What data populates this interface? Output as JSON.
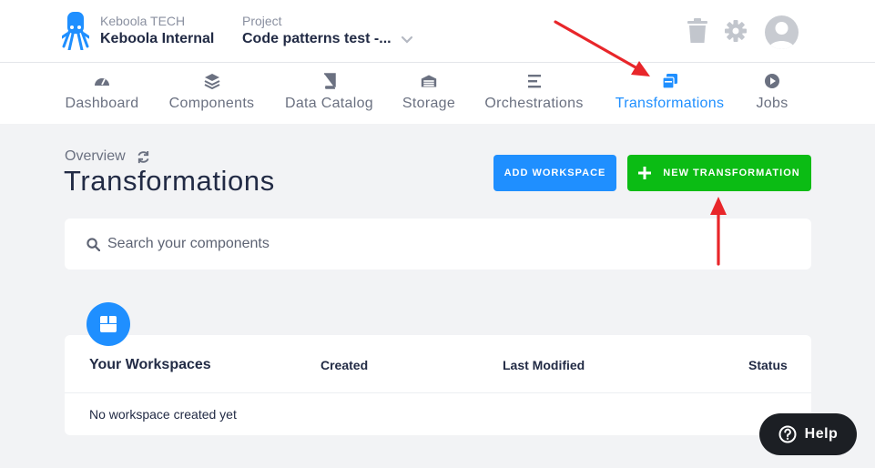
{
  "header": {
    "org_label": "Keboola TECH",
    "org_name": "Keboola Internal",
    "project_label": "Project",
    "project_name": "Code patterns test -..."
  },
  "nav": {
    "items": [
      {
        "label": "Dashboard",
        "icon": "dashboard-icon"
      },
      {
        "label": "Components",
        "icon": "layers-icon"
      },
      {
        "label": "Data Catalog",
        "icon": "book-icon"
      },
      {
        "label": "Storage",
        "icon": "warehouse-icon"
      },
      {
        "label": "Orchestrations",
        "icon": "bars-icon"
      },
      {
        "label": "Transformations",
        "icon": "window-icon",
        "active": true
      },
      {
        "label": "Jobs",
        "icon": "play-circle-icon"
      }
    ]
  },
  "page": {
    "breadcrumb": "Overview",
    "title": "Transformations"
  },
  "actions": {
    "add_workspace": "ADD WORKSPACE",
    "new_transformation": "NEW TRANSFORMATION"
  },
  "search": {
    "placeholder": "Search your components"
  },
  "workspaces": {
    "title": "Your Workspaces",
    "columns": [
      "Created",
      "Last Modified",
      "Status"
    ],
    "empty_text": "No workspace created yet"
  },
  "help": {
    "label": "Help"
  },
  "colors": {
    "accent": "#1f8fff",
    "success": "#0bbc14",
    "annotation": "#e8262a"
  }
}
